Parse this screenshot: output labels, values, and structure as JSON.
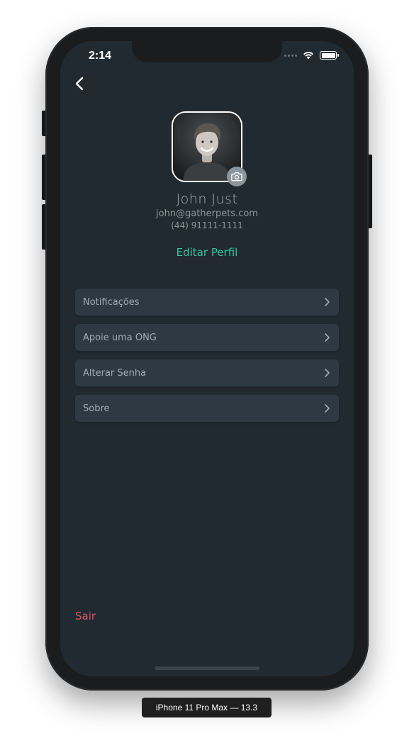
{
  "status_bar": {
    "time": "2:14"
  },
  "navigation": {
    "back_icon": "chevron-left-icon"
  },
  "profile": {
    "name": "John Just",
    "email": "john@gatherpets.com",
    "phone": "(44) 91111-1111",
    "edit_label": "Editar Perfil",
    "camera_icon": "camera-icon"
  },
  "menu": {
    "items": [
      {
        "label": "Notificações"
      },
      {
        "label": "Apoie uma ONG"
      },
      {
        "label": "Alterar Senha"
      },
      {
        "label": "Sobre"
      }
    ]
  },
  "logout_label": "Sair",
  "device_label": "iPhone 11 Pro Max — 13.3",
  "colors": {
    "background": "#212a31",
    "card": "#2d3a43",
    "accent": "#37c3a0",
    "danger": "#d9545c"
  }
}
